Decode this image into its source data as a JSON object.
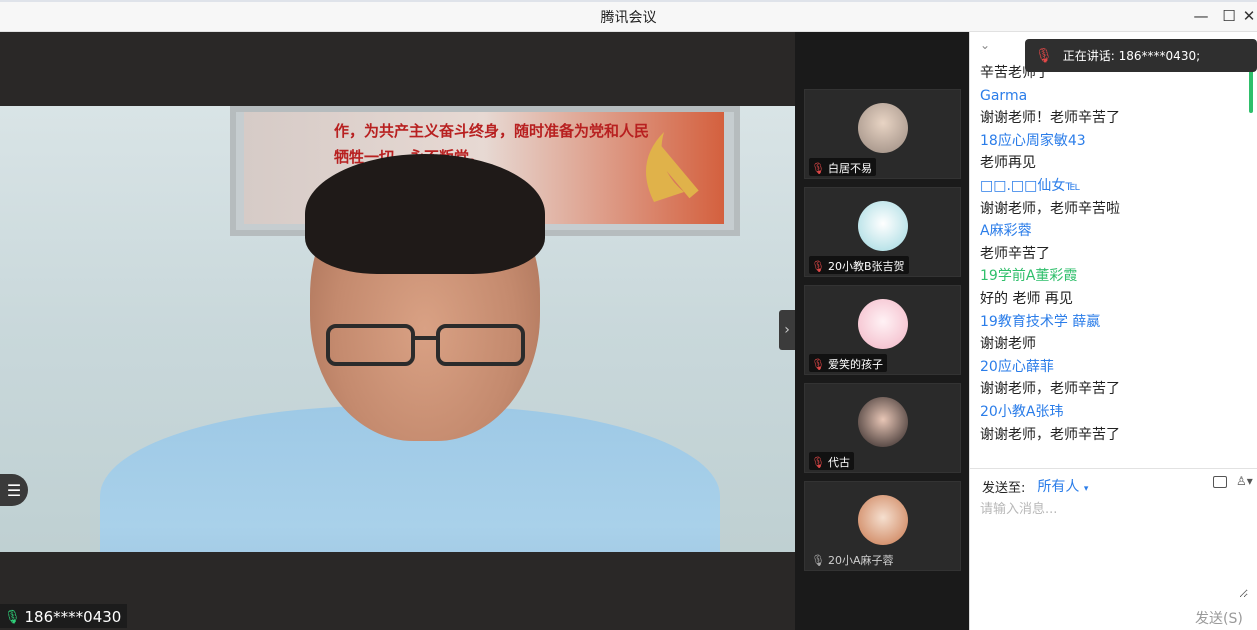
{
  "window": {
    "title": "腾讯会议",
    "min_label": "—",
    "max_label": "☐",
    "close_label": "✕"
  },
  "main_video": {
    "poster_line1": "作，为共产主义奋斗终身，随时准备为党和人民",
    "poster_line2": "牺牲一切，永不叛党。",
    "speaker_label": "186****0430"
  },
  "tiles": [
    {
      "name": "白居不易"
    },
    {
      "name": "20小教B张吉贺"
    },
    {
      "name": "爱笑的孩子"
    },
    {
      "name": "代古"
    },
    {
      "name": "20小A麻子蓉"
    }
  ],
  "speaking": {
    "label": "正在讲话: 186****0430;"
  },
  "chat": {
    "messages": [
      {
        "name": "",
        "text": "辛苦老师了"
      },
      {
        "name": "Garma",
        "color": "blue",
        "text": "谢谢老师！老师辛苦了"
      },
      {
        "name": "18应心周家敏43",
        "color": "blue",
        "text": "老师再见"
      },
      {
        "name": "□□.□□仙女℡",
        "color": "blue",
        "text": "谢谢老师，老师辛苦啦"
      },
      {
        "name": "A麻彩蓉",
        "color": "blue",
        "text": "老师辛苦了"
      },
      {
        "name": "19学前A董彩霞",
        "color": "green",
        "text": "好的  老师 再见"
      },
      {
        "name": "19教育技术学 薛嬴",
        "color": "blue",
        "text": "谢谢老师"
      },
      {
        "name": "20应心薛菲",
        "color": "blue",
        "text": "谢谢老师，老师辛苦了"
      },
      {
        "name": "20小教A张玮",
        "color": "blue",
        "text": "谢谢老师，老师辛苦了"
      }
    ],
    "send_to_label": "发送至:",
    "send_to_target": "所有人",
    "input_placeholder": "请输入消息...",
    "send_button": "发送(S)"
  }
}
